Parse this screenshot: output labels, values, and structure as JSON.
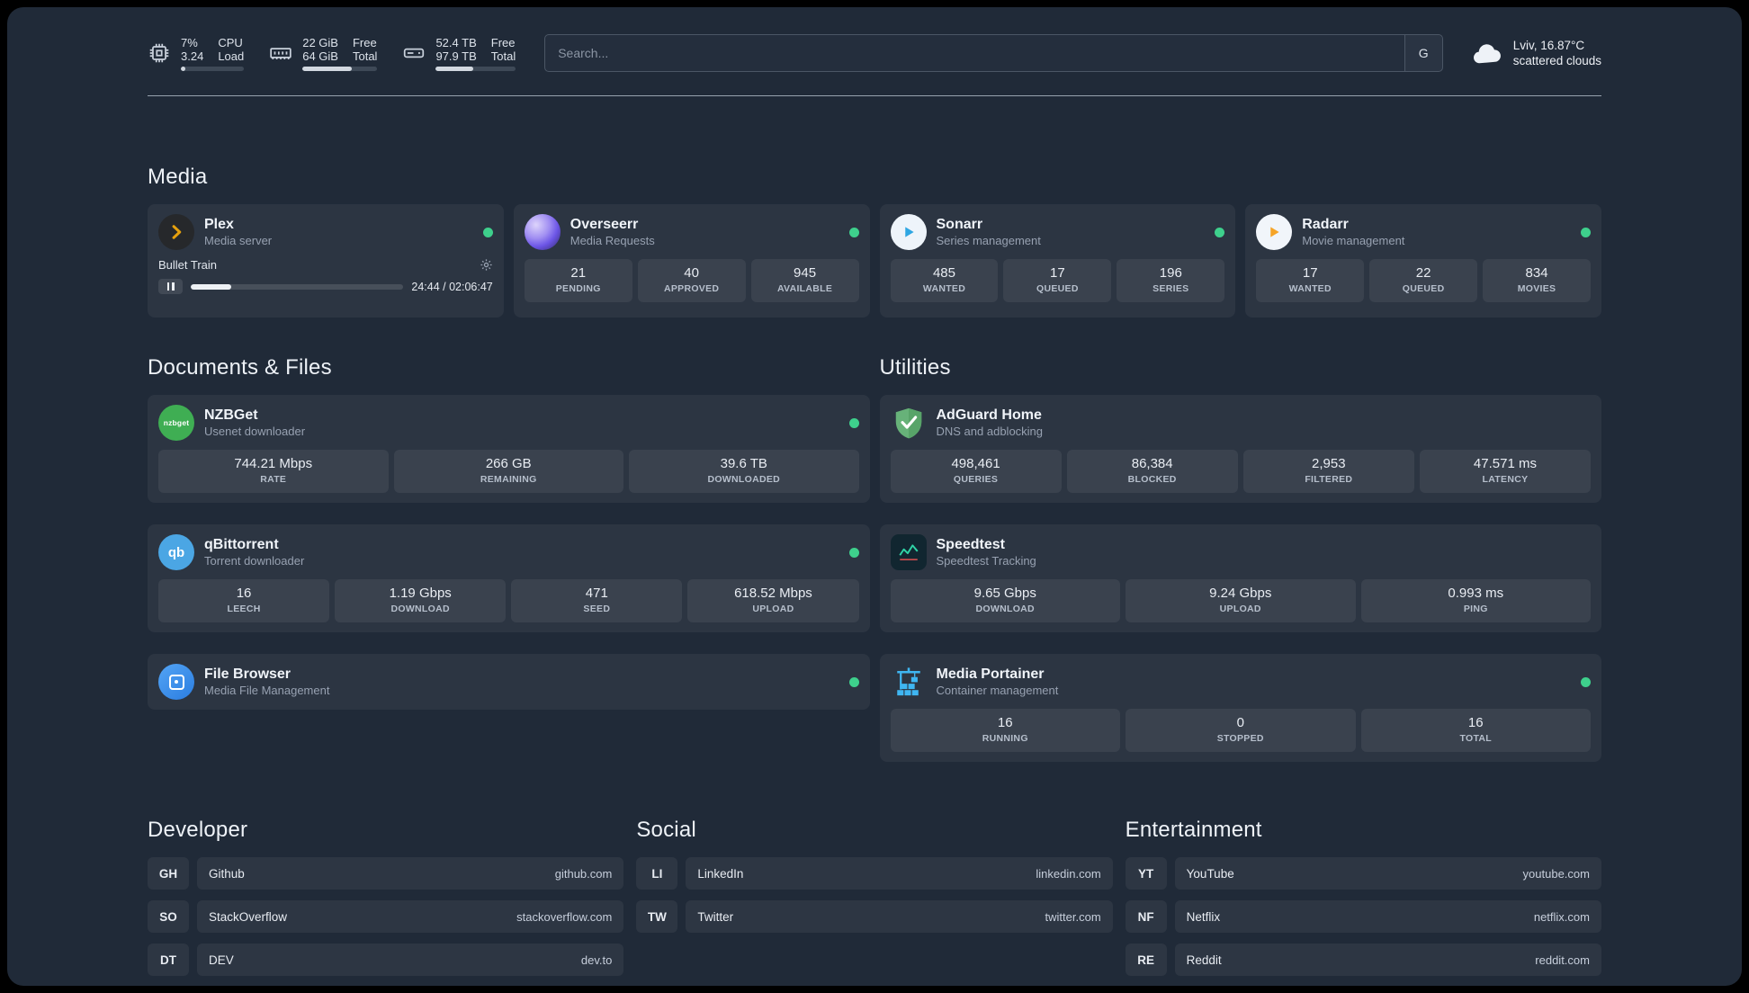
{
  "topbar": {
    "cpu": {
      "value1": "7%",
      "value2": "3.24",
      "label1": "CPU",
      "label2": "Load",
      "percent": 7
    },
    "ram": {
      "value1": "22 GiB",
      "value2": "64 GiB",
      "label1": "Free",
      "label2": "Total",
      "percent": 66
    },
    "disk": {
      "value1": "52.4 TB",
      "value2": "97.9 TB",
      "label1": "Free",
      "label2": "Total",
      "percent": 47
    },
    "search": {
      "placeholder": "Search...",
      "engine_label": "G"
    },
    "weather": {
      "location": "Lviv, 16.87°C",
      "condition": "scattered clouds"
    }
  },
  "media": {
    "title": "Media",
    "plex": {
      "name": "Plex",
      "subtitle": "Media server",
      "now_playing": "Bullet Train",
      "time": "24:44 / 02:06:47",
      "progress_percent": 19
    },
    "overseerr": {
      "name": "Overseerr",
      "subtitle": "Media Requests",
      "stats": [
        {
          "value": "21",
          "label": "PENDING"
        },
        {
          "value": "40",
          "label": "APPROVED"
        },
        {
          "value": "945",
          "label": "AVAILABLE"
        }
      ]
    },
    "sonarr": {
      "name": "Sonarr",
      "subtitle": "Series management",
      "stats": [
        {
          "value": "485",
          "label": "WANTED"
        },
        {
          "value": "17",
          "label": "QUEUED"
        },
        {
          "value": "196",
          "label": "SERIES"
        }
      ]
    },
    "radarr": {
      "name": "Radarr",
      "subtitle": "Movie management",
      "stats": [
        {
          "value": "17",
          "label": "WANTED"
        },
        {
          "value": "22",
          "label": "QUEUED"
        },
        {
          "value": "834",
          "label": "MOVIES"
        }
      ]
    }
  },
  "documents": {
    "title": "Documents & Files",
    "nzbget": {
      "name": "NZBGet",
      "subtitle": "Usenet downloader",
      "icon_label": "nzbget",
      "stats": [
        {
          "value": "744.21 Mbps",
          "label": "RATE"
        },
        {
          "value": "266 GB",
          "label": "REMAINING"
        },
        {
          "value": "39.6 TB",
          "label": "DOWNLOADED"
        }
      ]
    },
    "qbittorrent": {
      "name": "qBittorrent",
      "subtitle": "Torrent downloader",
      "icon_label": "qb",
      "stats": [
        {
          "value": "16",
          "label": "LEECH"
        },
        {
          "value": "1.19 Gbps",
          "label": "DOWNLOAD"
        },
        {
          "value": "471",
          "label": "SEED"
        },
        {
          "value": "618.52 Mbps",
          "label": "UPLOAD"
        }
      ]
    },
    "filebrowser": {
      "name": "File Browser",
      "subtitle": "Media File Management"
    }
  },
  "utilities": {
    "title": "Utilities",
    "adguard": {
      "name": "AdGuard Home",
      "subtitle": "DNS and adblocking",
      "stats": [
        {
          "value": "498,461",
          "label": "QUERIES"
        },
        {
          "value": "86,384",
          "label": "BLOCKED"
        },
        {
          "value": "2,953",
          "label": "FILTERED"
        },
        {
          "value": "47.571 ms",
          "label": "LATENCY"
        }
      ]
    },
    "speedtest": {
      "name": "Speedtest",
      "subtitle": "Speedtest Tracking",
      "stats": [
        {
          "value": "9.65 Gbps",
          "label": "DOWNLOAD"
        },
        {
          "value": "9.24 Gbps",
          "label": "UPLOAD"
        },
        {
          "value": "0.993 ms",
          "label": "PING"
        }
      ]
    },
    "portainer": {
      "name": "Media Portainer",
      "subtitle": "Container management",
      "stats": [
        {
          "value": "16",
          "label": "RUNNING"
        },
        {
          "value": "0",
          "label": "STOPPED"
        },
        {
          "value": "16",
          "label": "TOTAL"
        }
      ]
    }
  },
  "bookmarks": {
    "developer": {
      "title": "Developer",
      "items": [
        {
          "abbr": "GH",
          "name": "Github",
          "url": "github.com"
        },
        {
          "abbr": "SO",
          "name": "StackOverflow",
          "url": "stackoverflow.com"
        },
        {
          "abbr": "DT",
          "name": "DEV",
          "url": "dev.to"
        }
      ]
    },
    "social": {
      "title": "Social",
      "items": [
        {
          "abbr": "LI",
          "name": "LinkedIn",
          "url": "linkedin.com"
        },
        {
          "abbr": "TW",
          "name": "Twitter",
          "url": "twitter.com"
        }
      ]
    },
    "entertainment": {
      "title": "Entertainment",
      "items": [
        {
          "abbr": "YT",
          "name": "YouTube",
          "url": "youtube.com"
        },
        {
          "abbr": "NF",
          "name": "Netflix",
          "url": "netflix.com"
        },
        {
          "abbr": "RE",
          "name": "Reddit",
          "url": "reddit.com"
        }
      ]
    }
  },
  "colors": {
    "status_ok": "#3ed08c",
    "plex_accent": "#e5a00d",
    "background": "#202a38"
  }
}
